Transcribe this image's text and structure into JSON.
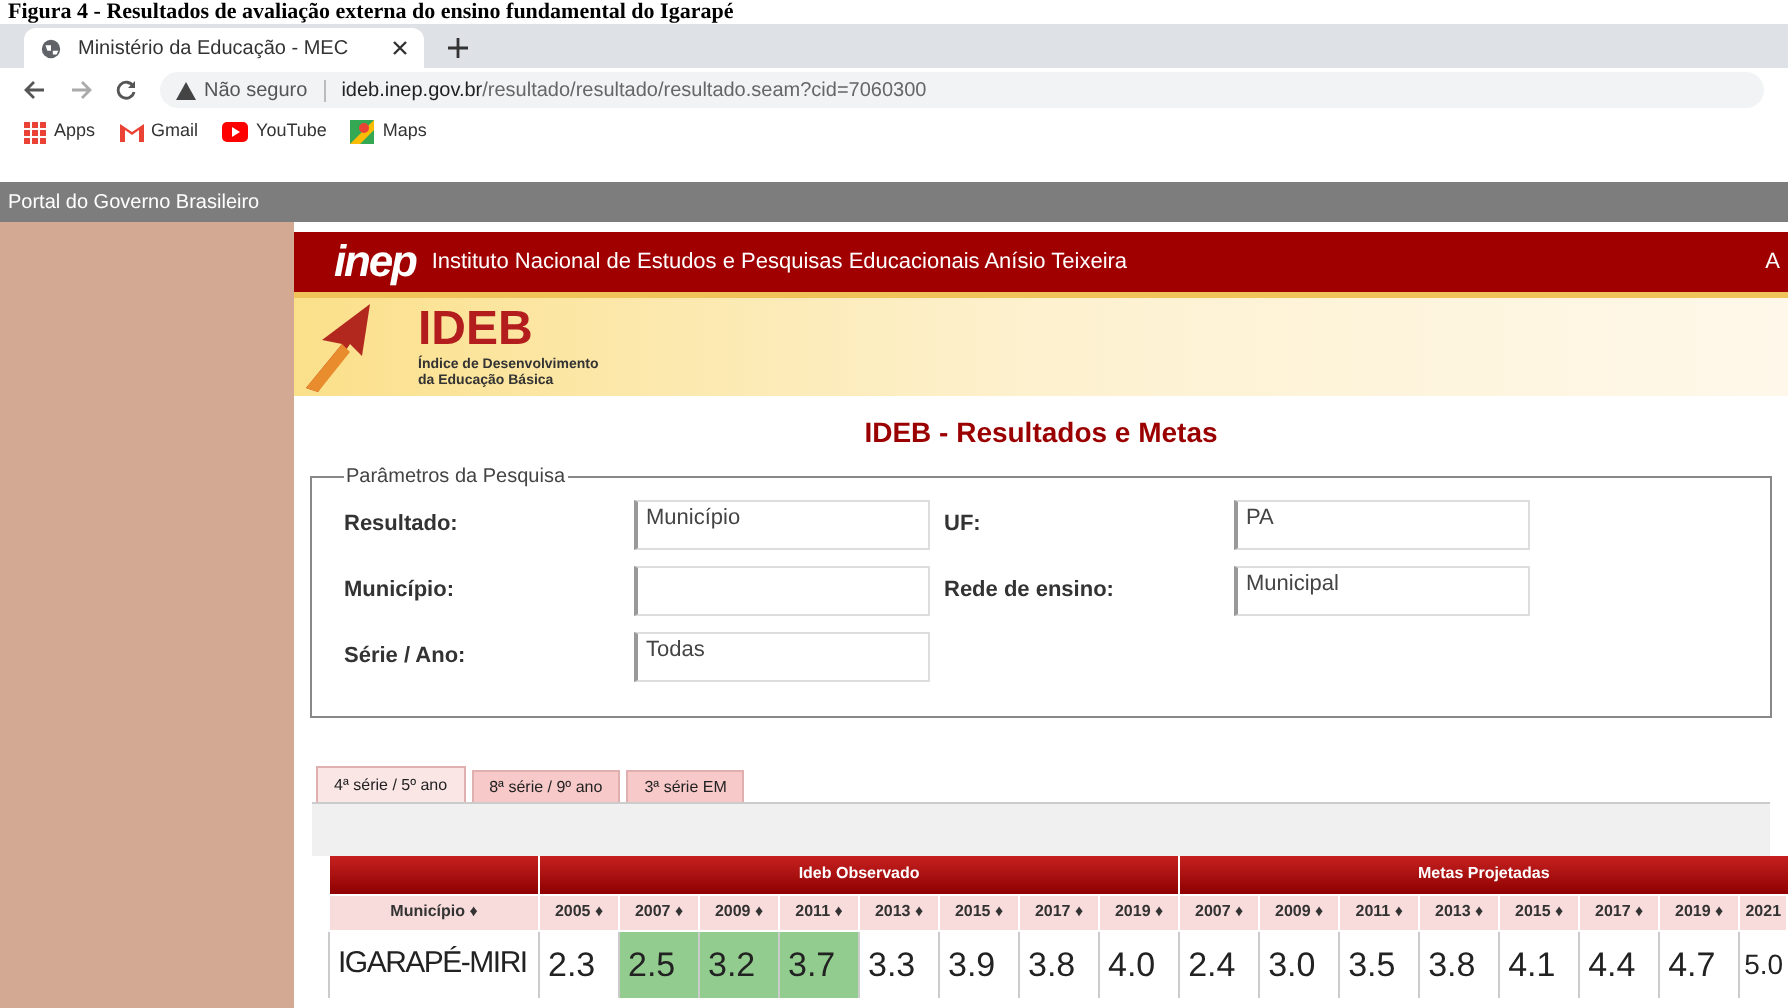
{
  "caption": "Figura 4 - Resultados de avaliação externa do ensino fundamental do Igarapé",
  "browser": {
    "tab_title": "Ministério da Educação - MEC",
    "security": "Não seguro",
    "url_host": "ideb.inep.gov.br",
    "url_path": "/resultado/resultado/resultado.seam?cid=7060300",
    "bookmarks": [
      {
        "kind": "apps",
        "label": "Apps"
      },
      {
        "kind": "gmail",
        "label": "Gmail"
      },
      {
        "kind": "youtube",
        "label": "YouTube"
      },
      {
        "kind": "maps",
        "label": "Maps"
      }
    ]
  },
  "gov_bar": "Portal do Governo Brasileiro",
  "inep": {
    "logo": "inep",
    "name": "Instituto Nacional de Estudos e Pesquisas Educacionais Anísio Teixeira",
    "right_text": "A"
  },
  "ideb_banner": {
    "title": "IDEB",
    "subtitle_1": "Índice de Desenvolvimento",
    "subtitle_2": "da Educação Básica"
  },
  "page_title": "IDEB - Resultados e Metas",
  "parameters": {
    "legend": "Parâmetros da Pesquisa",
    "fields": [
      {
        "label": "Resultado:",
        "value": "Município"
      },
      {
        "label": "UF:",
        "value": "PA"
      },
      {
        "label": "Município:"
      },
      {
        "label": "Rede de ensino:",
        "value": "Municipal"
      },
      {
        "label": "Série / Ano:",
        "value": "Todas"
      }
    ]
  },
  "tabs": [
    {
      "label": "4ª série / 5º ano",
      "selected": true
    },
    {
      "label": "8ª série / 9º ano",
      "selected": false
    },
    {
      "label": "3ª série EM",
      "selected": false
    }
  ],
  "table": {
    "groups": [
      "Ideb Observado",
      "Metas Projetadas"
    ],
    "first_column": "Município ♦",
    "observed_columns": [
      "2005 ♦",
      "2007 ♦",
      "2009 ♦",
      "2011 ♦",
      "2013 ♦",
      "2015 ♦",
      "2017 ♦",
      "2019 ♦"
    ],
    "projected_columns": [
      "2007 ♦",
      "2009 ♦",
      "2011 ♦",
      "2013 ♦",
      "2015 ♦",
      "2017 ♦",
      "2019 ♦",
      "2021"
    ],
    "rows": [
      {
        "name": "IGARAPÉ-MIRI",
        "observed": [
          {
            "value": "2.3",
            "highlighted": false
          },
          {
            "value": "2.5",
            "highlighted": true
          },
          {
            "value": "3.2",
            "highlighted": true
          },
          {
            "value": "3.7",
            "highlighted": true
          },
          {
            "value": "3.3",
            "highlighted": false
          },
          {
            "value": "3.9",
            "highlighted": false
          },
          {
            "value": "3.8",
            "highlighted": false
          },
          {
            "value": "4.0",
            "highlighted": false
          }
        ],
        "projected": [
          "2.4",
          "3.0",
          "3.5",
          "3.8",
          "4.1",
          "4.4",
          "4.7",
          "5.0"
        ]
      }
    ]
  }
}
